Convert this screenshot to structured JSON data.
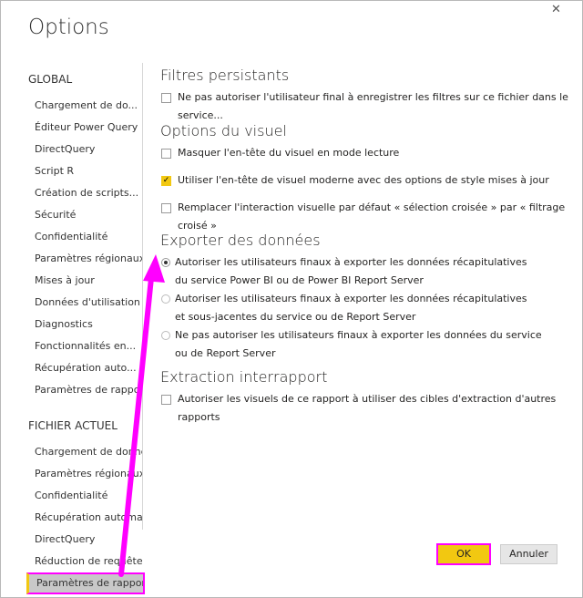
{
  "title": "Options",
  "close_label": "✕",
  "sidebar": {
    "global_header": "GLOBAL",
    "global_items": [
      "Chargement de do...",
      "Éditeur Power Query",
      "DirectQuery",
      "Script R",
      "Création de scripts...",
      "Sécurité",
      "Confidentialité",
      "Paramètres régionaux",
      "Mises à jour",
      "Données d'utilisation",
      "Diagnostics",
      "Fonctionnalités en...",
      "Récupération auto...",
      "Paramètres de rapport"
    ],
    "file_header": "FICHIER ACTUEL",
    "file_items": [
      "Chargement de données",
      "Paramètres régionaux",
      "Confidentialité",
      "Récupération automatique",
      "DirectQuery",
      "Réduction de requête",
      "Paramètres de rapport"
    ]
  },
  "main": {
    "filters_title": "Filtres persistants",
    "filters_opt": "Ne pas autoriser l'utilisateur final à enregistrer les filtres sur ce fichier dans le service...",
    "visual_title": "Options du visuel",
    "visual_opts": [
      "Masquer l'en-tête du visuel en mode lecture",
      "Utiliser l'en-tête de visuel moderne avec des options de style mises à jour",
      "Remplacer l'interaction visuelle par défaut « sélection croisée » par « filtrage croisé »"
    ],
    "export_title": "Exporter des données",
    "export_opts": [
      {
        "l1": "Autoriser les utilisateurs finaux à exporter les données récapitulatives",
        "l2": "du service Power BI ou de Power BI Report Server"
      },
      {
        "l1": "Autoriser les utilisateurs finaux à exporter les données récapitulatives",
        "l2": "et sous-jacentes du service ou de Report Server"
      },
      {
        "l1": "Ne pas autoriser les utilisateurs finaux à exporter les données du service",
        "l2": "ou de Report Server"
      }
    ],
    "drill_title": "Extraction interrapport",
    "drill_opt": "Autoriser les visuels de ce rapport à utiliser des cibles d'extraction d'autres rapports"
  },
  "buttons": {
    "ok": "OK",
    "cancel": "Annuler"
  }
}
